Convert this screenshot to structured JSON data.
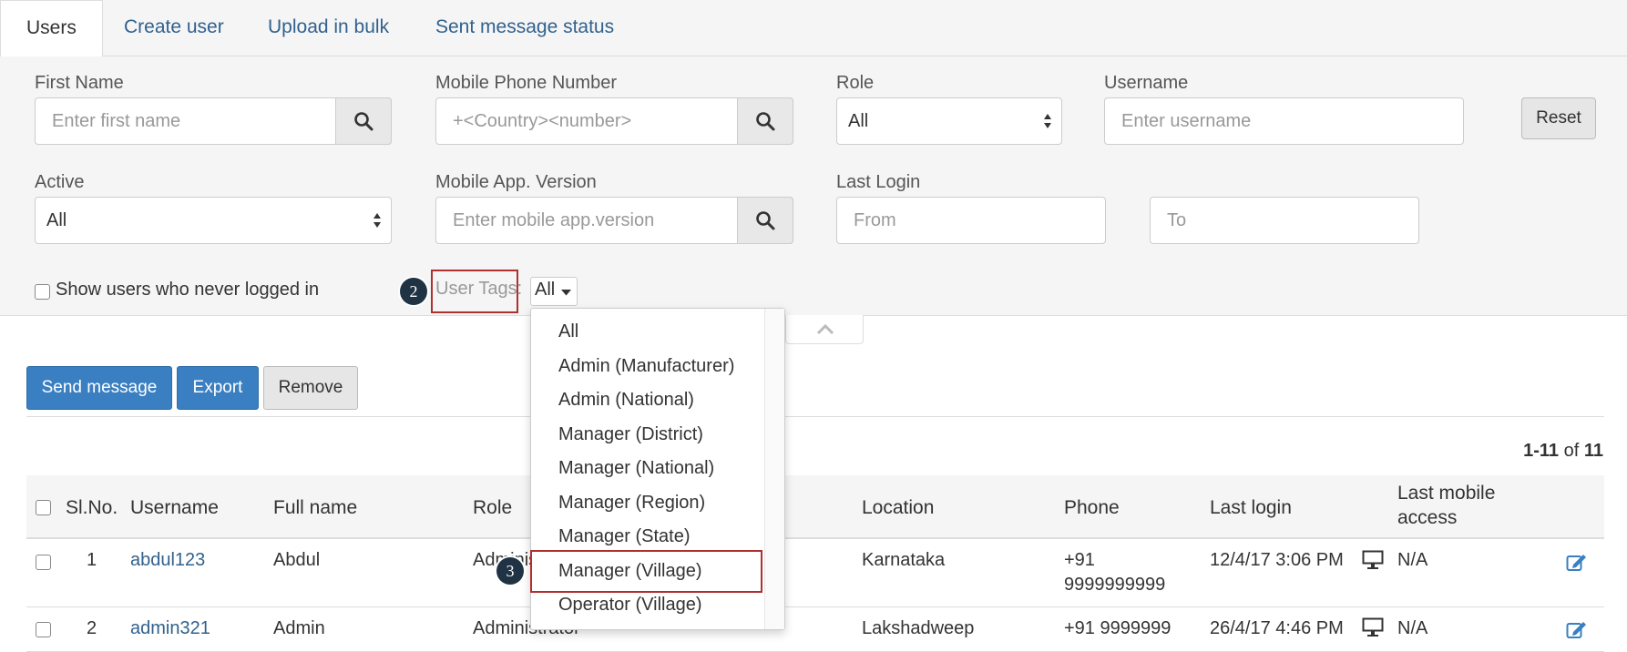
{
  "tabs": [
    {
      "label": "Users",
      "active": true
    },
    {
      "label": "Create user",
      "active": false
    },
    {
      "label": "Upload in bulk",
      "active": false
    },
    {
      "label": "Sent message status",
      "active": false
    }
  ],
  "filters": {
    "first_name": {
      "label": "First Name",
      "placeholder": "Enter first name"
    },
    "mobile": {
      "label": "Mobile Phone Number",
      "placeholder": "+<Country><number>"
    },
    "role": {
      "label": "Role",
      "value": "All"
    },
    "username": {
      "label": "Username",
      "placeholder": "Enter username"
    },
    "reset_label": "Reset",
    "active": {
      "label": "Active",
      "value": "All"
    },
    "app_version": {
      "label": "Mobile App. Version",
      "placeholder": "Enter mobile app.version"
    },
    "last_login": {
      "label": "Last Login",
      "from_placeholder": "From",
      "to_placeholder": "To"
    },
    "never_logged_label": "Show users who never logged in",
    "user_tags": {
      "label": "User Tags:",
      "value": "All"
    }
  },
  "markers": {
    "user_tags": "2",
    "manager_village": "3"
  },
  "actions": {
    "send_message": "Send message",
    "export": "Export",
    "remove": "Remove"
  },
  "pagination": {
    "range": "1-11",
    "of": "of",
    "total": "11"
  },
  "table": {
    "headers": {
      "slno": "Sl.No.",
      "username": "Username",
      "fullname": "Full name",
      "role": "Role",
      "location": "Location",
      "phone": "Phone",
      "last_login": "Last login",
      "last_mobile_line1": "Last mobile",
      "last_mobile_line2": "access"
    },
    "rows": [
      {
        "slno": "1",
        "username": "abdul123",
        "fullname": "Abdul",
        "role": "Administrator",
        "location": "Karnataka",
        "phone_line1": "+91",
        "phone_line2": "9999999999",
        "last_login": "12/4/17 3:06 PM",
        "last_mobile": "N/A"
      },
      {
        "slno": "2",
        "username": "admin321",
        "fullname": "Admin",
        "role": "Administrator",
        "location": "Lakshadweep",
        "phone_line1": "+91 9999999",
        "phone_line2": "",
        "last_login": "26/4/17 4:46 PM",
        "last_mobile": "N/A"
      }
    ]
  },
  "tag_options": [
    "All",
    "Admin (Manufacturer)",
    "Admin (National)",
    "Manager (District)",
    "Manager (National)",
    "Manager (Region)",
    "Manager (State)",
    "Manager (Village)",
    "Operator (Village)"
  ],
  "colors": {
    "link": "#31618e",
    "primary": "#3a7fc1",
    "highlight": "#b03030",
    "marker": "#1f3344"
  }
}
